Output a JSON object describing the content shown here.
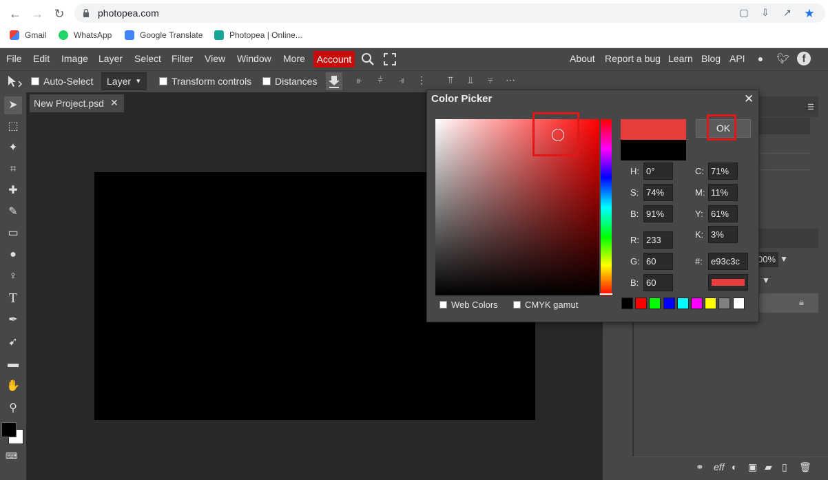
{
  "browser": {
    "url": "photopea.com",
    "bookmarks": [
      "Gmail",
      "WhatsApp",
      "Google Translate",
      "Photopea | Online..."
    ]
  },
  "menu": {
    "items": [
      "File",
      "Edit",
      "Image",
      "Layer",
      "Select",
      "Filter",
      "View",
      "Window",
      "More"
    ],
    "account": "Account",
    "right": [
      "About",
      "Report a bug",
      "Learn",
      "Blog",
      "API"
    ]
  },
  "options": {
    "auto_select": "Auto-Select",
    "layer_select": "Layer",
    "transform_controls": "Transform controls",
    "distances": "Distances"
  },
  "document": {
    "tab_label": "New Project.psd",
    "close": "✕"
  },
  "dialog": {
    "title": "Color Picker",
    "close": "✕",
    "ok_label": "OK",
    "fields": {
      "H": "0°",
      "S": "74%",
      "B": "91%",
      "R": "233",
      "G": "60",
      "B2": "60",
      "C": "71%",
      "M": "11%",
      "Y": "61%",
      "K": "3%",
      "hex": "e93c3c"
    },
    "labels": {
      "H": "H:",
      "S": "S:",
      "B": "B:",
      "R": "R:",
      "G": "G:",
      "B2": "B:",
      "C": "C:",
      "M": "M:",
      "Y": "Y:",
      "K": "K:",
      "hex": "#:"
    },
    "web_colors": "Web Colors",
    "cmyk_gamut": "CMYK gamut",
    "new_color": "#e93c3c",
    "old_color": "#000000",
    "quick_swatches": [
      "#000000",
      "#ff0000",
      "#00ff00",
      "#0000ff",
      "#00ffff",
      "#ff00ff",
      "#ffff00",
      "#808080",
      "#ffffff"
    ]
  },
  "right_panel": {
    "partial_value": "00%"
  },
  "colors": {
    "accent_red": "#c70c0c",
    "highlight": "#e01818"
  }
}
